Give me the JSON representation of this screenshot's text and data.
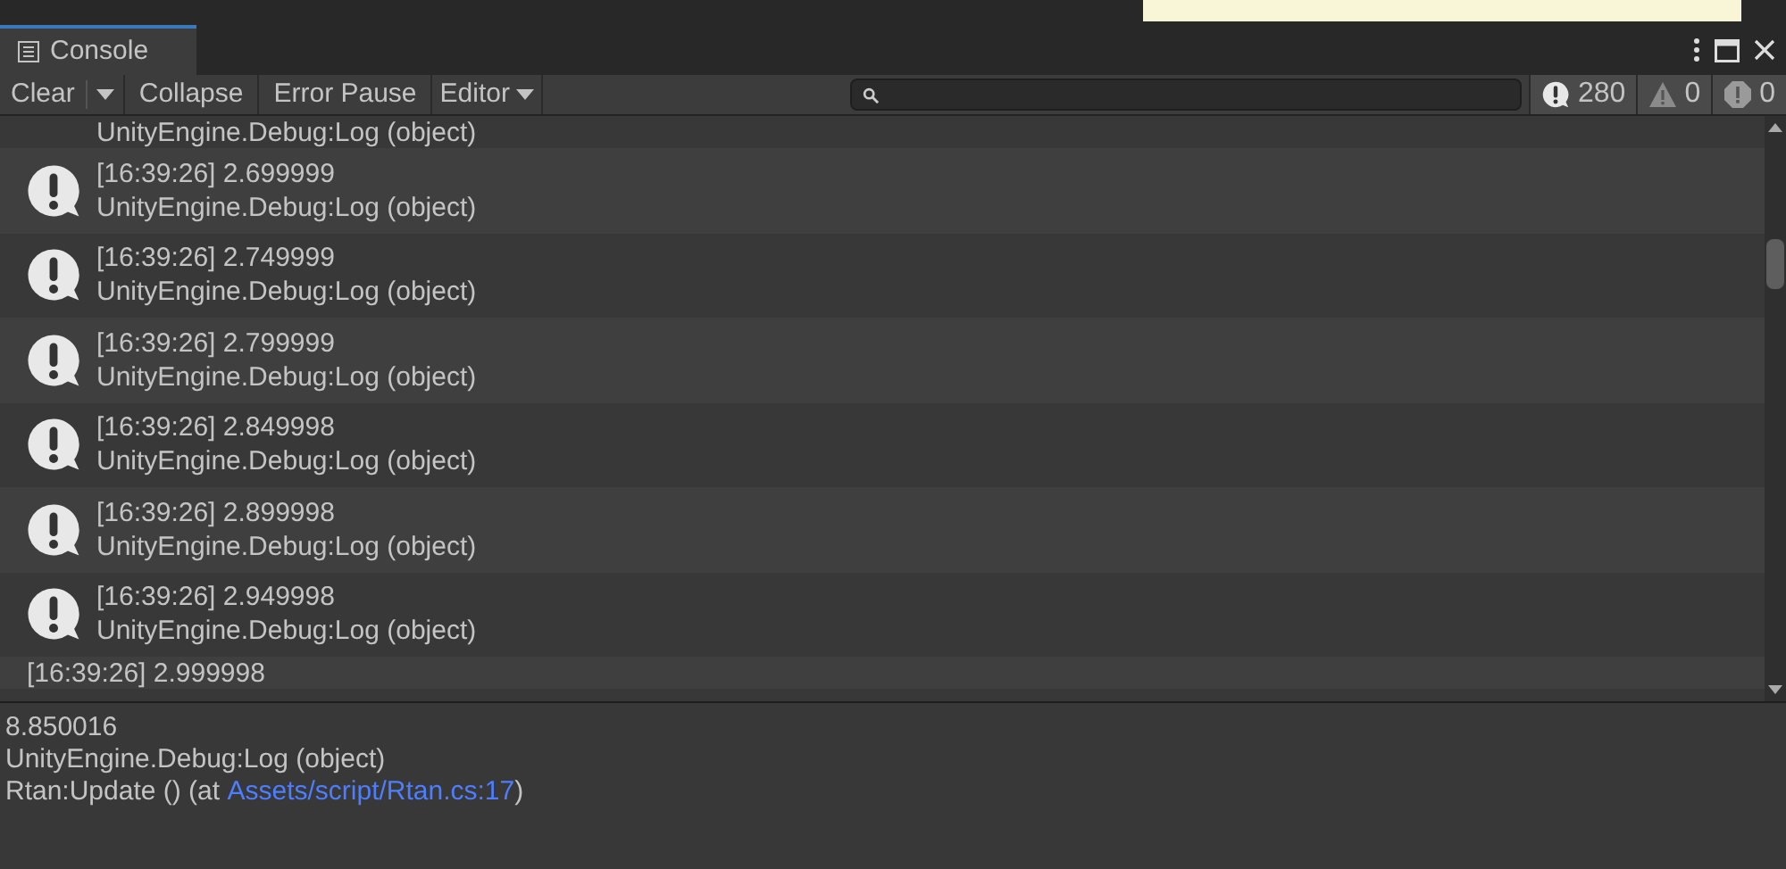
{
  "tab": {
    "title": "Console"
  },
  "toolbar": {
    "clear": "Clear",
    "collapse": "Collapse",
    "error_pause": "Error Pause",
    "editor": "Editor"
  },
  "counters": [
    {
      "kind": "log",
      "count": "280"
    },
    {
      "kind": "warning",
      "count": "0"
    },
    {
      "kind": "error",
      "count": "0"
    }
  ],
  "logs": [
    {
      "detail": "UnityEngine.Debug:Log (object)"
    },
    {
      "message": "[16:39:26] 2.699999",
      "detail": "UnityEngine.Debug:Log (object)"
    },
    {
      "message": "[16:39:26] 2.749999",
      "detail": "UnityEngine.Debug:Log (object)"
    },
    {
      "message": "[16:39:26] 2.799999",
      "detail": "UnityEngine.Debug:Log (object)"
    },
    {
      "message": "[16:39:26] 2.849998",
      "detail": "UnityEngine.Debug:Log (object)"
    },
    {
      "message": "[16:39:26] 2.899998",
      "detail": "UnityEngine.Debug:Log (object)"
    },
    {
      "message": "[16:39:26] 2.949998",
      "detail": "UnityEngine.Debug:Log (object)"
    },
    {
      "message": "[16:39:26] 2.999998"
    }
  ],
  "details": {
    "lines": [
      "8.850016",
      "UnityEngine.Debug:Log (object)"
    ],
    "trace_prefix": "Rtan:Update () (at ",
    "trace_link": "Assets/script/Rtan.cs:17",
    "trace_suffix": ")"
  }
}
